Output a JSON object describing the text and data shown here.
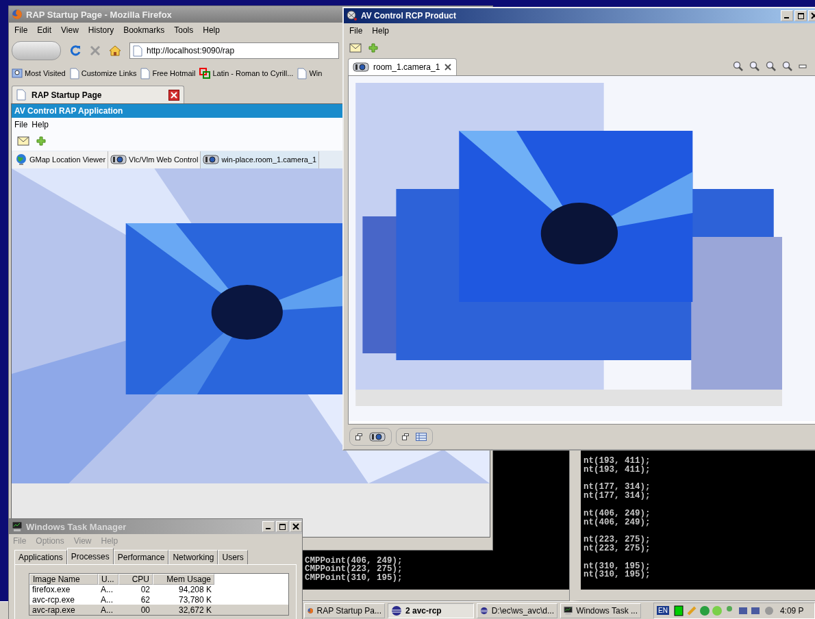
{
  "firefox": {
    "title": "RAP Startup Page - Mozilla Firefox",
    "menu": [
      "File",
      "Edit",
      "View",
      "History",
      "Bookmarks",
      "Tools",
      "Help"
    ],
    "url": "http://localhost:9090/rap",
    "bookmarks": [
      {
        "label": "Most Visited",
        "kind": "folder"
      },
      {
        "label": "Customize Links",
        "kind": "page"
      },
      {
        "label": "Free Hotmail",
        "kind": "page"
      },
      {
        "label": "Latin - Roman to Cyrill...",
        "kind": "squares"
      },
      {
        "label": "Win",
        "kind": "page"
      }
    ],
    "tab": "RAP Startup Page",
    "app": {
      "title": "AV Control RAP Application",
      "menu": [
        "File",
        "Help"
      ],
      "tabs": [
        {
          "label": "GMap Location Viewer",
          "kind": "globe",
          "selected": false
        },
        {
          "label": "Vlc/Vlm Web Control",
          "kind": "camera",
          "selected": false
        },
        {
          "label": "win-place.room_1.camera_1",
          "kind": "camera",
          "selected": true
        }
      ]
    }
  },
  "rcp": {
    "title": "AV Control RCP Product",
    "menu": [
      "File",
      "Help"
    ],
    "tab": "room_1.camera_1"
  },
  "consoles": [
    {
      "groups": [
        [
          "CMPPoint(406, 249);",
          "CMPPoint(223, 275);",
          "CMPPoint(310, 195);"
        ]
      ]
    },
    {
      "groups": [
        [
          "nt(193, 411);",
          "nt(193, 411);"
        ],
        [
          "nt(177, 314);",
          "nt(177, 314);"
        ],
        [
          "nt(406, 249);",
          "nt(406, 249);"
        ],
        [
          "nt(223, 275);",
          "nt(223, 275);"
        ],
        [
          "nt(310, 195);",
          "nt(310, 195);"
        ]
      ]
    }
  ],
  "task_manager": {
    "title": "Windows Task Manager",
    "menu": [
      "File",
      "Options",
      "View",
      "Help"
    ],
    "tabs": [
      {
        "label": "Applications",
        "selected": false
      },
      {
        "label": "Processes",
        "selected": true
      },
      {
        "label": "Performance",
        "selected": false
      },
      {
        "label": "Networking",
        "selected": false
      },
      {
        "label": "Users",
        "selected": false
      }
    ],
    "columns": [
      "Image Name",
      "U...",
      "CPU",
      "Mem Usage"
    ],
    "rows": [
      {
        "cells": [
          "firefox.exe",
          "A...",
          "02",
          "94,208 K"
        ],
        "selected": false
      },
      {
        "cells": [
          "avc-rcp.exe",
          "A...",
          "62",
          "73,780 K"
        ],
        "selected": false
      },
      {
        "cells": [
          "avc-rap.exe",
          "A...",
          "00",
          "32,672 K"
        ],
        "selected": true
      }
    ]
  },
  "taskbar": {
    "buttons": [
      {
        "label": "RAP Startup Pa...",
        "kind": "firefox",
        "selected": false
      },
      {
        "label": "2 avc-rcp",
        "kind": "sphere",
        "selected": true
      },
      {
        "label": "D:\\ec\\ws_avc\\d...",
        "kind": "sphere",
        "selected": false
      },
      {
        "label": "Windows Task ...",
        "kind": "monitor",
        "selected": false
      }
    ],
    "language": "EN",
    "clock": "4:09 P"
  }
}
